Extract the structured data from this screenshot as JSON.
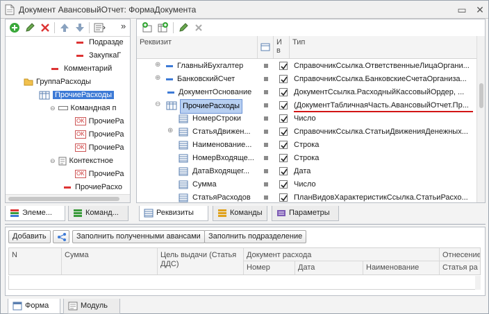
{
  "window": {
    "title": "Документ АвансовыйОтчет: ФормаДокумента"
  },
  "left_tree": {
    "items": [
      {
        "label": "Подразде",
        "icon": "red-dash-icon"
      },
      {
        "label": "ЗакупкаГ",
        "icon": "red-dash-icon"
      },
      {
        "label": "Комментарий",
        "icon": "red-dash-icon"
      },
      {
        "label": "ГруппаРасходы",
        "icon": "folder-icon"
      },
      {
        "label": "ПрочиеРасходы",
        "icon": "table-icon"
      },
      {
        "label": "Командная п",
        "icon": "command-bar-icon"
      },
      {
        "label": "ПрочиеРа",
        "icon": "ok-icon"
      },
      {
        "label": "ПрочиеРа",
        "icon": "ok-icon"
      },
      {
        "label": "ПрочиеРа",
        "icon": "ok-icon"
      },
      {
        "label": "Контекстное",
        "icon": "context-menu-icon"
      },
      {
        "label": "ПрочиеРа",
        "icon": "ok-icon"
      },
      {
        "label": "ПрочиеРасхо",
        "icon": "red-dash-icon"
      }
    ],
    "tabs": [
      {
        "label": "Элеме..."
      },
      {
        "label": "Команд..."
      }
    ]
  },
  "right_grid": {
    "headers": {
      "rekvizit": "Реквизит",
      "use": "И",
      "use2": "в",
      "type": "Тип"
    },
    "rows": [
      {
        "name": "ГлавныйБухгалтер",
        "type": "СправочникСсылка.ОтветственныеЛицаОргани...",
        "checked": true
      },
      {
        "name": "БанковскийСчет",
        "type": "СправочникСсылка.БанковскиеСчетаОрганиза...",
        "checked": true
      },
      {
        "name": "ДокументОснование",
        "type": "ДокументСсылка.РасходныйКассовыйОрдер, ...",
        "checked": true
      },
      {
        "name": "ПрочиеРасходы",
        "type": "(ДокументТабличнаяЧасть.АвансовыйОтчет.Пр...",
        "checked": true
      },
      {
        "name": "НомерСтроки",
        "type": "Число",
        "checked": true
      },
      {
        "name": "СтатьяДвижен...",
        "type": "СправочникСсылка.СтатьиДвиженияДенежных...",
        "checked": true
      },
      {
        "name": "Наименование...",
        "type": "Строка",
        "checked": true
      },
      {
        "name": "НомерВходяще...",
        "type": "Строка",
        "checked": true
      },
      {
        "name": "ДатаВходящег...",
        "type": "Дата",
        "checked": true
      },
      {
        "name": "Сумма",
        "type": "Число",
        "checked": true
      },
      {
        "name": "СтатьяРасходов",
        "type": "ПланВидовХарактеристикСсылка.СтатьиРасхо...",
        "checked": true
      }
    ],
    "tabs": [
      {
        "label": "Реквизиты"
      },
      {
        "label": "Команды"
      },
      {
        "label": "Параметры"
      }
    ]
  },
  "bottom": {
    "buttons": {
      "add": "Добавить",
      "fill_advances": "Заполнить полученными авансами",
      "fill_division": "Заполнить подразделение"
    },
    "table": {
      "n": "N",
      "sum": "Сумма",
      "purpose": "Цель выдачи (Статья ДДС)",
      "doc_group": "Документ расхода",
      "doc_number": "Номер",
      "doc_date": "Дата",
      "doc_name": "Наименование",
      "attrib_group": "Отнесение",
      "attrib_item": "Статья ра"
    },
    "tabs": [
      {
        "label": "Форма"
      },
      {
        "label": "Модуль"
      }
    ]
  },
  "colors": {
    "selection": "#3d7ad6",
    "underline": "#d21414",
    "accent_green": "#2e9a2e"
  }
}
